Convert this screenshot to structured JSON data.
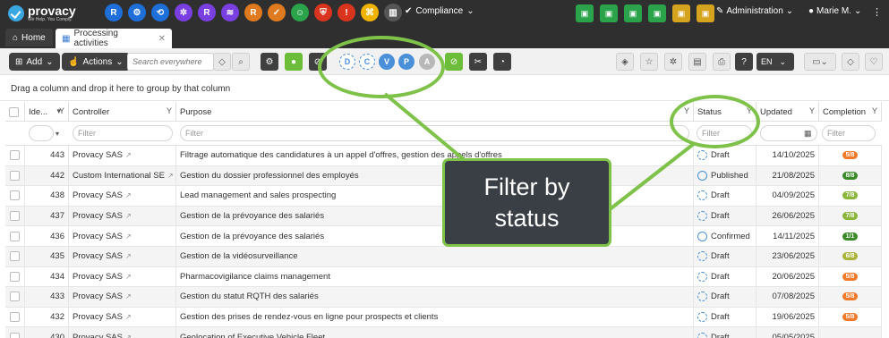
{
  "app": {
    "name": "provacy",
    "tagline": "We Help. You Comply.",
    "compliance_menu": "Compliance",
    "administration_menu": "Administration",
    "user_menu": "Marie M.",
    "module_icons": [
      {
        "name": "registry-r-icon",
        "letter": "R",
        "color": "#1e6fd9"
      },
      {
        "name": "network-icon",
        "letter": "⚙",
        "color": "#1e6fd9"
      },
      {
        "name": "share-icon",
        "letter": "⟲",
        "color": "#1e6fd9"
      },
      {
        "name": "gear-icon",
        "letter": "✲",
        "color": "#7a3fe0"
      },
      {
        "name": "registry-r2-icon",
        "letter": "R",
        "color": "#7a3fe0"
      },
      {
        "name": "layers-icon",
        "letter": "≋",
        "color": "#7a3fe0"
      },
      {
        "name": "registry-r3-icon",
        "letter": "R",
        "color": "#e07a1e"
      },
      {
        "name": "calendar-check-icon",
        "letter": "✓",
        "color": "#e07a1e"
      },
      {
        "name": "person-shield-icon",
        "letter": "☺",
        "color": "#2aa34a"
      },
      {
        "name": "shield-icon",
        "letter": "⛨",
        "color": "#d9341e"
      },
      {
        "name": "alert-icon",
        "letter": "!",
        "color": "#d9341e"
      },
      {
        "name": "sitemap-icon",
        "letter": "⌘",
        "color": "#f0b400"
      },
      {
        "name": "library-icon",
        "letter": "▥",
        "color": "#555555"
      }
    ],
    "right_icons": [
      {
        "name": "building-icon",
        "color": "#2aa34a"
      },
      {
        "name": "org-chart-icon",
        "color": "#2aa34a"
      },
      {
        "name": "document-org-icon",
        "color": "#2aa34a"
      },
      {
        "name": "group-icon",
        "color": "#2aa34a"
      },
      {
        "name": "users-icon",
        "color": "#d6a31e"
      },
      {
        "name": "tools-icon",
        "color": "#d6a31e"
      }
    ]
  },
  "tabs": {
    "home": "Home",
    "active": "Processing activities"
  },
  "toolbar": {
    "add": "Add",
    "actions": "Actions",
    "search_placeholder": "Search everywhere",
    "status_filters": [
      "D",
      "C",
      "V",
      "P",
      "A"
    ],
    "language": "EN"
  },
  "group_hint": "Drag a column and drop it here to group by that column",
  "columns": {
    "id": "Ide...",
    "controller": "Controller",
    "purpose": "Purpose",
    "status": "Status",
    "updated": "Updated",
    "completion": "Completion"
  },
  "filter_placeholder": "Filter",
  "rows": [
    {
      "id": "443",
      "controller": "Provacy SAS",
      "purpose": "Filtrage automatique des candidatures à un appel d'offres, gestion des appels d'offres",
      "status": "Draft",
      "updated": "14/10/2025",
      "completion": "5/8",
      "badge_color": "#f07a2a"
    },
    {
      "id": "442",
      "controller": "Custom International SE",
      "purpose": "Gestion du dossier professionnel des employés",
      "status": "Published",
      "updated": "21/08/2025",
      "completion": "8/8",
      "badge_color": "#3a8a2a"
    },
    {
      "id": "438",
      "controller": "Provacy SAS",
      "purpose": "Lead management and sales prospecting",
      "status": "Draft",
      "updated": "04/09/2025",
      "completion": "7/8",
      "badge_color": "#8ab43a"
    },
    {
      "id": "437",
      "controller": "Provacy SAS",
      "purpose": "Gestion de la prévoyance des salariés",
      "status": "Draft",
      "updated": "26/06/2025",
      "completion": "7/8",
      "badge_color": "#8ab43a"
    },
    {
      "id": "436",
      "controller": "Provacy SAS",
      "purpose": "Gestion de la prévoyance des salariés",
      "status": "Confirmed",
      "updated": "14/11/2025",
      "completion": "1/1",
      "badge_color": "#3a8a2a"
    },
    {
      "id": "435",
      "controller": "Provacy SAS",
      "purpose": "Gestion de la vidéosurveillance",
      "status": "Draft",
      "updated": "23/06/2025",
      "completion": "6/8",
      "badge_color": "#a8b43a"
    },
    {
      "id": "434",
      "controller": "Provacy SAS",
      "purpose": "Pharmacovigilance claims management",
      "status": "Draft",
      "updated": "20/06/2025",
      "completion": "5/8",
      "badge_color": "#f07a2a"
    },
    {
      "id": "433",
      "controller": "Provacy SAS",
      "purpose": "Gestion du statut RQTH des salariés",
      "status": "Draft",
      "updated": "07/08/2025",
      "completion": "5/8",
      "badge_color": "#f07a2a"
    },
    {
      "id": "432",
      "controller": "Provacy SAS",
      "purpose": "Gestion des prises de rendez-vous en ligne pour prospects et clients",
      "status": "Draft",
      "updated": "19/06/2025",
      "completion": "5/8",
      "badge_color": "#f07a2a"
    },
    {
      "id": "430",
      "controller": "Provacy SAS",
      "purpose": "Geolocation of Executive Vehicle Fleet",
      "status": "Draft",
      "updated": "05/05/2025",
      "completion": "",
      "badge_color": "#f07a2a"
    }
  ],
  "callout": {
    "line1": "Filter by",
    "line2": "status"
  }
}
